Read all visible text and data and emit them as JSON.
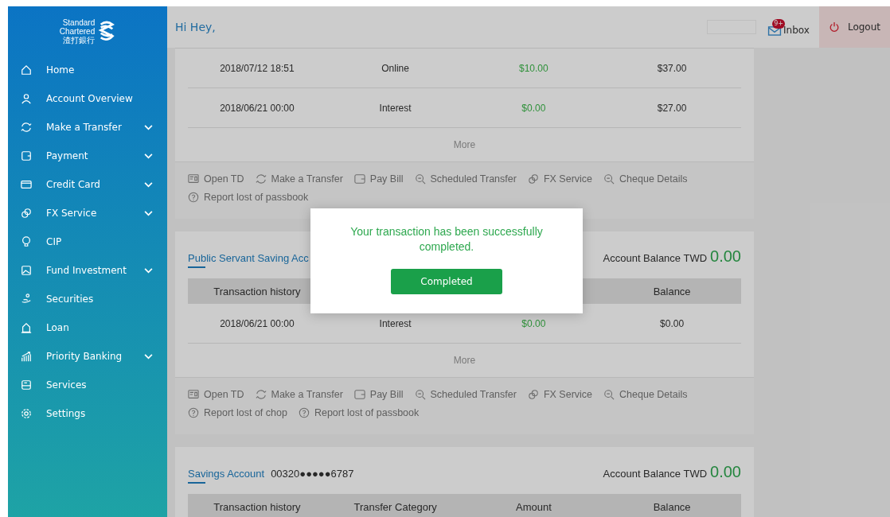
{
  "greeting": "Hi Hey,",
  "header": {
    "inbox": {
      "label": "Inbox",
      "badge": "9+"
    },
    "logout": "Logout"
  },
  "sidebar": {
    "logo": {
      "line_1": "Standard",
      "line_2": "Chartered",
      "line_3": "渣打銀行"
    },
    "items": [
      {
        "label": "Home",
        "expandable": false
      },
      {
        "label": "Account Overview",
        "expandable": false
      },
      {
        "label": "Make a Transfer",
        "expandable": true
      },
      {
        "label": "Payment",
        "expandable": true
      },
      {
        "label": "Credit Card",
        "expandable": true
      },
      {
        "label": "FX Service",
        "expandable": true
      },
      {
        "label": "CIP",
        "expandable": false
      },
      {
        "label": "Fund Investment",
        "expandable": true
      },
      {
        "label": "Securities",
        "expandable": false
      },
      {
        "label": "Loan",
        "expandable": false
      },
      {
        "label": "Priority Banking",
        "expandable": true
      },
      {
        "label": "Services",
        "expandable": false
      },
      {
        "label": "Settings",
        "expandable": false
      }
    ]
  },
  "accounts": [
    {
      "rows": [
        [
          "2018/07/12 18:51",
          "Online",
          "$10.00",
          "$37.00"
        ],
        [
          "2018/06/21 00:00",
          "Interest",
          "$0.00",
          "$27.00"
        ]
      ],
      "more": "More",
      "actions": [
        {
          "kind": "td",
          "label": "Open TD"
        },
        {
          "kind": "transfer",
          "label": "Make a Transfer"
        },
        {
          "kind": "bill",
          "label": "Pay Bill"
        },
        {
          "kind": "search",
          "label": "Scheduled Transfer"
        },
        {
          "kind": "fx",
          "label": "FX Service"
        },
        {
          "kind": "search",
          "label": "Cheque Details"
        },
        {
          "kind": "help",
          "label": "Report lost of passbook"
        }
      ]
    },
    {
      "name": "Public Servant Saving Acc",
      "balance_label": "Account Balance TWD",
      "balance": "0.00",
      "columns": [
        "Transaction history",
        "",
        "",
        "Balance"
      ],
      "rows": [
        [
          "2018/06/21 00:00",
          "Interest",
          "$0.00",
          "$0.00"
        ]
      ],
      "more": "More",
      "actions": [
        {
          "kind": "td",
          "label": "Open TD"
        },
        {
          "kind": "transfer",
          "label": "Make a Transfer"
        },
        {
          "kind": "bill",
          "label": "Pay Bill"
        },
        {
          "kind": "search",
          "label": "Scheduled Transfer"
        },
        {
          "kind": "fx",
          "label": "FX Service"
        },
        {
          "kind": "search",
          "label": "Cheque Details"
        },
        {
          "kind": "help",
          "label": "Report lost of chop"
        },
        {
          "kind": "help",
          "label": "Report lost of passbook"
        }
      ]
    },
    {
      "name": "Savings Account",
      "number": "00320●●●●●6787",
      "balance_label": "Account Balance TWD",
      "balance": "0.00",
      "columns": [
        "Transaction history",
        "Transfer Category",
        "Amount",
        "Balance"
      ]
    }
  ],
  "dialog": {
    "message": "Your transaction has been successfully completed.",
    "button": "Completed"
  }
}
